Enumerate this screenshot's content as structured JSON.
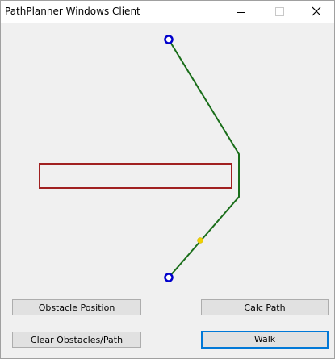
{
  "window": {
    "title": "PathPlanner Windows Client"
  },
  "icons": {
    "minimize": "minimize-icon",
    "maximize": "maximize-icon",
    "close": "close-icon"
  },
  "colors": {
    "path": "#1a6e1a",
    "obstacle": "#a02020",
    "waypoint": "#0000cc",
    "walker": "#f0d000"
  },
  "buttons": {
    "obstacle_position": "Obstacle Position",
    "calc_path": "Calc Path",
    "clear": "Clear Obstacles/Path",
    "walk": "Walk"
  }
}
